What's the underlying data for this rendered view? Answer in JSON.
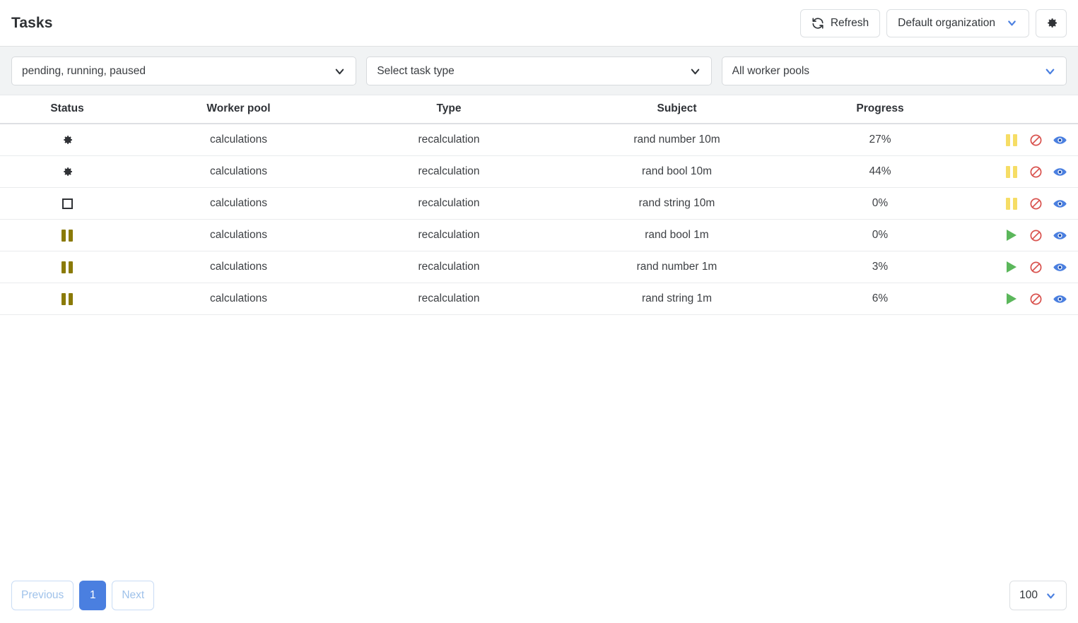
{
  "header": {
    "title": "Tasks",
    "refresh_label": "Refresh",
    "refresh_icon": "refresh-icon",
    "org_label": "Default organization",
    "org_chevron_icon": "chevron-down-icon",
    "settings_icon": "gear-icon"
  },
  "filters": [
    {
      "name": "status-filter",
      "value": "pending, running, paused",
      "chevron_color": "#2f3338"
    },
    {
      "name": "task-type-filter",
      "value": "Select task type",
      "chevron_color": "#2f3338"
    },
    {
      "name": "worker-pool-filter",
      "value": "All worker pools",
      "chevron_color": "#4a7fe0"
    }
  ],
  "table": {
    "columns": [
      "Status",
      "Worker pool",
      "Type",
      "Subject",
      "Progress"
    ],
    "rows": [
      {
        "status_icon": "gear-icon",
        "status": "running",
        "worker_pool": "calculations",
        "type": "recalculation",
        "subject": "rand number 10m",
        "progress": "27%",
        "toggle_icon": "pause-icon",
        "cancel_icon": "no-entry-icon",
        "view_icon": "eye-icon"
      },
      {
        "status_icon": "gear-icon",
        "status": "running",
        "worker_pool": "calculations",
        "type": "recalculation",
        "subject": "rand bool 10m",
        "progress": "44%",
        "toggle_icon": "pause-icon",
        "cancel_icon": "no-entry-icon",
        "view_icon": "eye-icon"
      },
      {
        "status_icon": "square-icon",
        "status": "pending",
        "worker_pool": "calculations",
        "type": "recalculation",
        "subject": "rand string 10m",
        "progress": "0%",
        "toggle_icon": "pause-icon",
        "cancel_icon": "no-entry-icon",
        "view_icon": "eye-icon"
      },
      {
        "status_icon": "pause-icon",
        "status": "paused",
        "worker_pool": "calculations",
        "type": "recalculation",
        "subject": "rand bool 1m",
        "progress": "0%",
        "toggle_icon": "play-icon",
        "cancel_icon": "no-entry-icon",
        "view_icon": "eye-icon"
      },
      {
        "status_icon": "pause-icon",
        "status": "paused",
        "worker_pool": "calculations",
        "type": "recalculation",
        "subject": "rand number 1m",
        "progress": "3%",
        "toggle_icon": "play-icon",
        "cancel_icon": "no-entry-icon",
        "view_icon": "eye-icon"
      },
      {
        "status_icon": "pause-icon",
        "status": "paused",
        "worker_pool": "calculations",
        "type": "recalculation",
        "subject": "rand string 1m",
        "progress": "6%",
        "toggle_icon": "play-icon",
        "cancel_icon": "no-entry-icon",
        "view_icon": "eye-icon"
      }
    ]
  },
  "footer": {
    "previous_label": "Previous",
    "page_label": "1",
    "next_label": "Next",
    "page_size": "100",
    "page_size_chevron_icon": "chevron-down-icon"
  },
  "colors": {
    "accent_blue": "#4a7fe0",
    "status_pause": "#8a7a08",
    "action_pause": "#f6dd65",
    "action_play": "#5bb75b",
    "action_cancel": "#d9534f",
    "action_view": "#4a7fe0"
  }
}
